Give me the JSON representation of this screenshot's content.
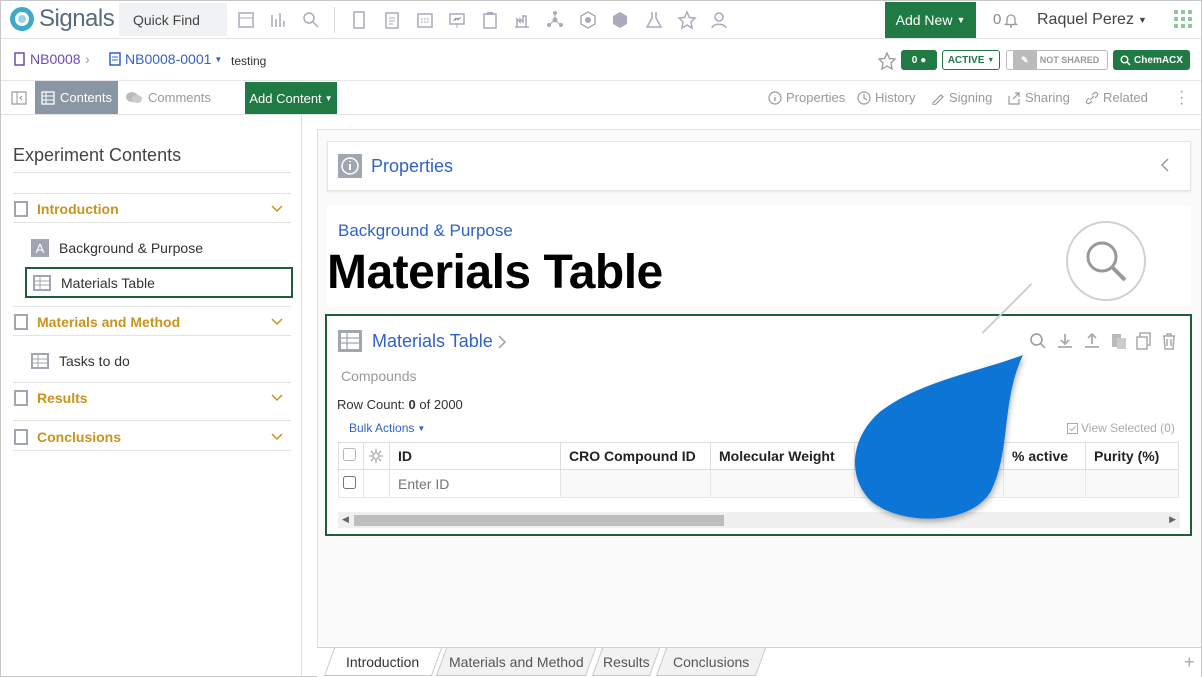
{
  "app": {
    "name": "Signals"
  },
  "topbar": {
    "quick_find": "Quick Find",
    "add_new": "Add New",
    "notif_count": "0",
    "user": "Raquel Perez"
  },
  "breadcrumb": {
    "notebook": "NB0008",
    "experiment": "NB0008-0001",
    "name": "testing"
  },
  "status": {
    "comments_count": "0",
    "active": "ACTIVE",
    "shared": "NOT SHARED",
    "chemacx": "ChemACX"
  },
  "toolbar": {
    "contents": "Contents",
    "comments": "Comments",
    "add_content": "Add Content",
    "properties": "Properties",
    "history": "History",
    "signing": "Signing",
    "sharing": "Sharing",
    "related": "Related"
  },
  "sidebar": {
    "title": "Experiment Contents",
    "sections": [
      {
        "label": "Introduction"
      },
      {
        "label": "Materials and Method"
      },
      {
        "label": "Results"
      },
      {
        "label": "Conclusions"
      }
    ],
    "items": [
      {
        "label": "Background & Purpose"
      },
      {
        "label": "Materials Table"
      },
      {
        "label": "Tasks to do"
      }
    ]
  },
  "main": {
    "properties_title": "Properties",
    "background_title": "Background & Purpose",
    "overlay_title": "Materials Table",
    "materials": {
      "title": "Materials Table",
      "subtitle": "Compounds",
      "row_count_label": "Row Count:",
      "row_count": "0",
      "row_count_total": "of 2000",
      "bulk_actions": "Bulk Actions",
      "view_selected": "View Selected (0)",
      "columns": [
        "ID",
        "CRO Compound ID",
        "Molecular Weight",
        "",
        "% active",
        "Purity (%)"
      ],
      "enter_id_placeholder": "Enter ID"
    }
  },
  "bottom_tabs": [
    "Introduction",
    "Materials and Method",
    "Results",
    "Conclusions"
  ],
  "colors": {
    "primary_green": "#1f7a43",
    "link_blue": "#2f63c7",
    "section_gold": "#c8941b",
    "callout_blue": "#0a74d6"
  }
}
